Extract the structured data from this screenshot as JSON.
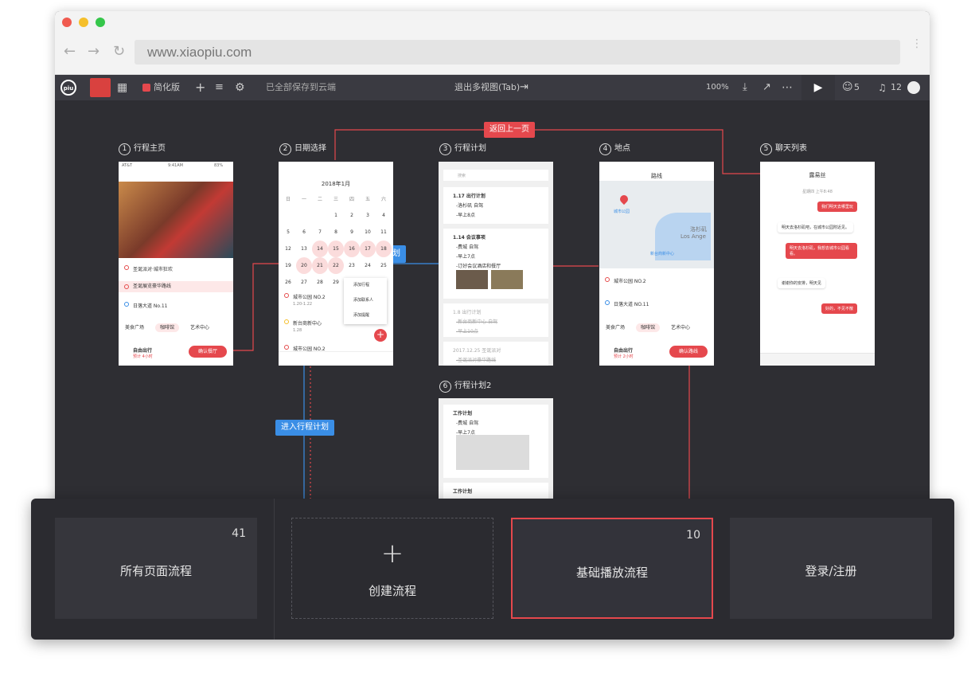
{
  "browser": {
    "url": "www.xiaopiu.com"
  },
  "toolbar": {
    "logo": "piu",
    "simplify_label": "简化版",
    "save_status": "已全部保存到云端",
    "exit_multiview": "退出多视图(Tab)",
    "zoom": "100%",
    "users_count": "5",
    "notifications_count": "12"
  },
  "phones": [
    {
      "num": "1",
      "label": "行程主页"
    },
    {
      "num": "2",
      "label": "日期选择"
    },
    {
      "num": "3",
      "label": "行程计划"
    },
    {
      "num": "4",
      "label": "地点"
    },
    {
      "num": "5",
      "label": "聊天列表"
    },
    {
      "num": "6",
      "label": "行程计划2"
    }
  ],
  "connectors": {
    "back_tag": "返回上一页",
    "enter_plan_tag1": "进入行程计划",
    "enter_plan_tag2": "进入行程计划"
  },
  "phone1": {
    "status_carrier": "AT&T",
    "status_time": "9:41AM",
    "status_battery": "83%",
    "items": [
      "圣诞派对·城市狂欢",
      "圣诞展览豪华路线",
      "日落大道 No.11"
    ],
    "categories": [
      "美食广场",
      "咖啡馆",
      "艺术中心"
    ],
    "free_trip": "自由出行",
    "free_trip_sub": "预计 4小时",
    "confirm_button": "确认餐厅"
  },
  "phone2": {
    "month": "2018年1月",
    "weekdays": [
      "日",
      "一",
      "二",
      "三",
      "四",
      "五",
      "六"
    ],
    "rows": [
      [
        "",
        "",
        "",
        "1",
        "2",
        "3",
        "4"
      ],
      [
        "5",
        "6",
        "7",
        "8",
        "9",
        "10",
        "11"
      ],
      [
        "12",
        "13",
        "14",
        "15",
        "16",
        "17",
        "18"
      ],
      [
        "19",
        "20",
        "21",
        "22",
        "23",
        "24",
        "25"
      ],
      [
        "26",
        "27",
        "28",
        "29",
        "30",
        "31",
        ""
      ]
    ],
    "events": [
      "城市公园 NO.2",
      "新台商新中心",
      "城市公园 NO.2"
    ],
    "event_times": [
      "1.20-1.22",
      "1.28"
    ],
    "menu": [
      "添加行程",
      "添加联系人",
      "添加提醒"
    ]
  },
  "phone3": {
    "search_placeholder": "搜索",
    "card1_title": "1.17 出行计划",
    "card1_lines": [
      "-洛杉矶 自驾",
      "-早上8点"
    ],
    "card2_title": "1.14 会议事项",
    "card2_lines": [
      "-费城 自驾",
      "-早上7点",
      "-订好会议酒店和餐厅"
    ],
    "card3_title": "1.8 出行计划",
    "card3_lines": [
      "-新台商新中心 自驾",
      "-早上10点"
    ],
    "card4_title": "2017.12.25 圣诞派对",
    "card4_lines": [
      "-圣诞派对豪华路线"
    ]
  },
  "phone4": {
    "title": "路线",
    "map_labels": [
      "城市公园",
      "Los Ange",
      "洛杉矶",
      "新台商新中心"
    ],
    "items": [
      "城市公园 NO.2",
      "日落大道 NO.11"
    ],
    "categories": [
      "美食广场",
      "咖啡馆",
      "艺术中心"
    ],
    "drive": "自由出行",
    "drive_sub": "预计 2小时",
    "confirm_button": "确认路线"
  },
  "phone5": {
    "title": "露易丝",
    "time_label": "星期四 上午8:48",
    "messages": [
      "我们明天去哪里玩",
      "明天去洛杉矶吧，在城市公园附近见。",
      "明天去洛杉矶，我想去城市公园看看。",
      "谢谢你的安排，明天见",
      "好的，不见不散"
    ]
  },
  "phone6": {
    "card1_title": "工作计划",
    "card1_lines": [
      "-费城 自驾",
      "-早上7点"
    ],
    "card2_title": "工作计划"
  },
  "bottom_panel": {
    "all_flows_label": "所有页面流程",
    "all_flows_count": "41",
    "create_flow_label": "创建流程",
    "basic_flow_label": "基础播放流程",
    "basic_flow_count": "10",
    "login_label": "登录/注册"
  },
  "colors": {
    "accent_red": "#e5484d",
    "accent_blue": "#3a8ee6",
    "canvas": "#2e2e33"
  }
}
